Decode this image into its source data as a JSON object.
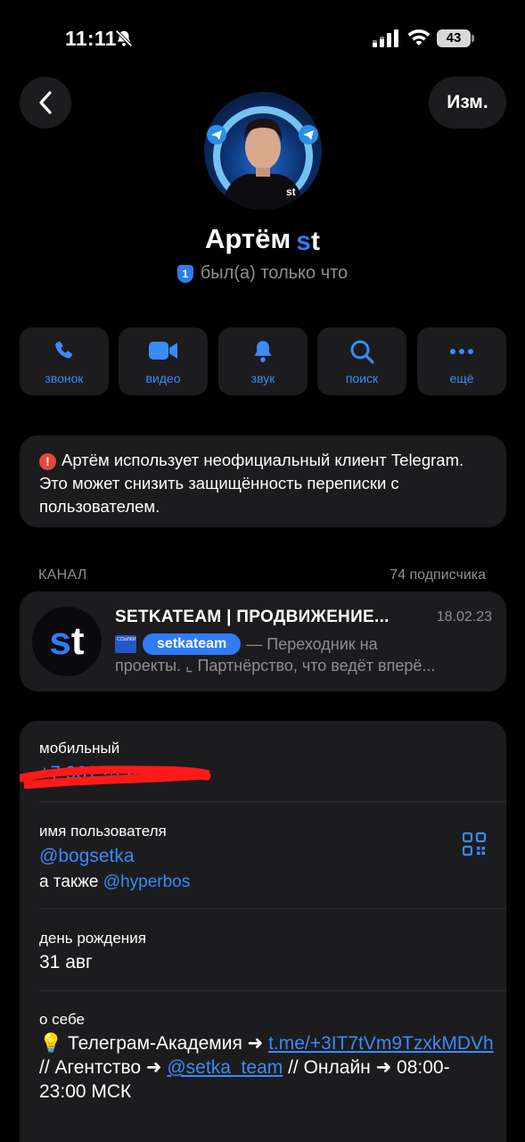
{
  "status_bar": {
    "time": "11:11",
    "battery": "43"
  },
  "nav": {
    "edit_label": "Изм."
  },
  "profile": {
    "name": "Артём",
    "name_logo_s": "s",
    "name_logo_t": "t",
    "badge": "1",
    "status": "был(а) только что"
  },
  "actions": [
    {
      "label": "звонок",
      "icon": "phone-icon"
    },
    {
      "label": "видео",
      "icon": "video-icon"
    },
    {
      "label": "звук",
      "icon": "bell-icon"
    },
    {
      "label": "поиск",
      "icon": "search-icon"
    },
    {
      "label": "ещё",
      "icon": "more-icon"
    }
  ],
  "warning": {
    "icon": "!",
    "text": "Артём использует неофициальный клиент Telegram. Это может снизить защищённость переписки с пользователем."
  },
  "channel": {
    "section_label": "КАНАЛ",
    "subscribers": "74 подписчика",
    "title": "SETKATEAM | ПРОДВИЖЕНИЕ...",
    "date": "18.02.23",
    "mini_icon_text": "ССЫЛКИ НА ПРОЕКТЫ",
    "tag": "setkateam",
    "preview_1": "— Переходник на",
    "preview_2": "проекты.  ⌞ Партнёрство, что ведёт вперё..."
  },
  "info": {
    "mobile_label": "мобильный",
    "mobile_value": "+7 961 ··· ·· ··",
    "username_label": "имя пользователя",
    "username": "@bogsetka",
    "also_prefix": "а также",
    "also_username": "@hyperbos",
    "birthday_label": "день рождения",
    "birthday": "31 авг",
    "about_label": "о себе",
    "about_emoji": "💡",
    "about_text_1": " Телеграм-Академия ➜ ",
    "about_link_1": "t.me/+3IT7tVm9TzxkMDVh",
    "about_text_2": " // Агентство ➜ ",
    "about_link_2": "@setka_team",
    "about_text_3": " // Онлайн ➜ 08:00-23:00 МСК"
  },
  "colors": {
    "accent": "#3b8bf7",
    "card": "#1c1c1e",
    "muted": "#8e8e93",
    "danger": "#e8453c"
  }
}
